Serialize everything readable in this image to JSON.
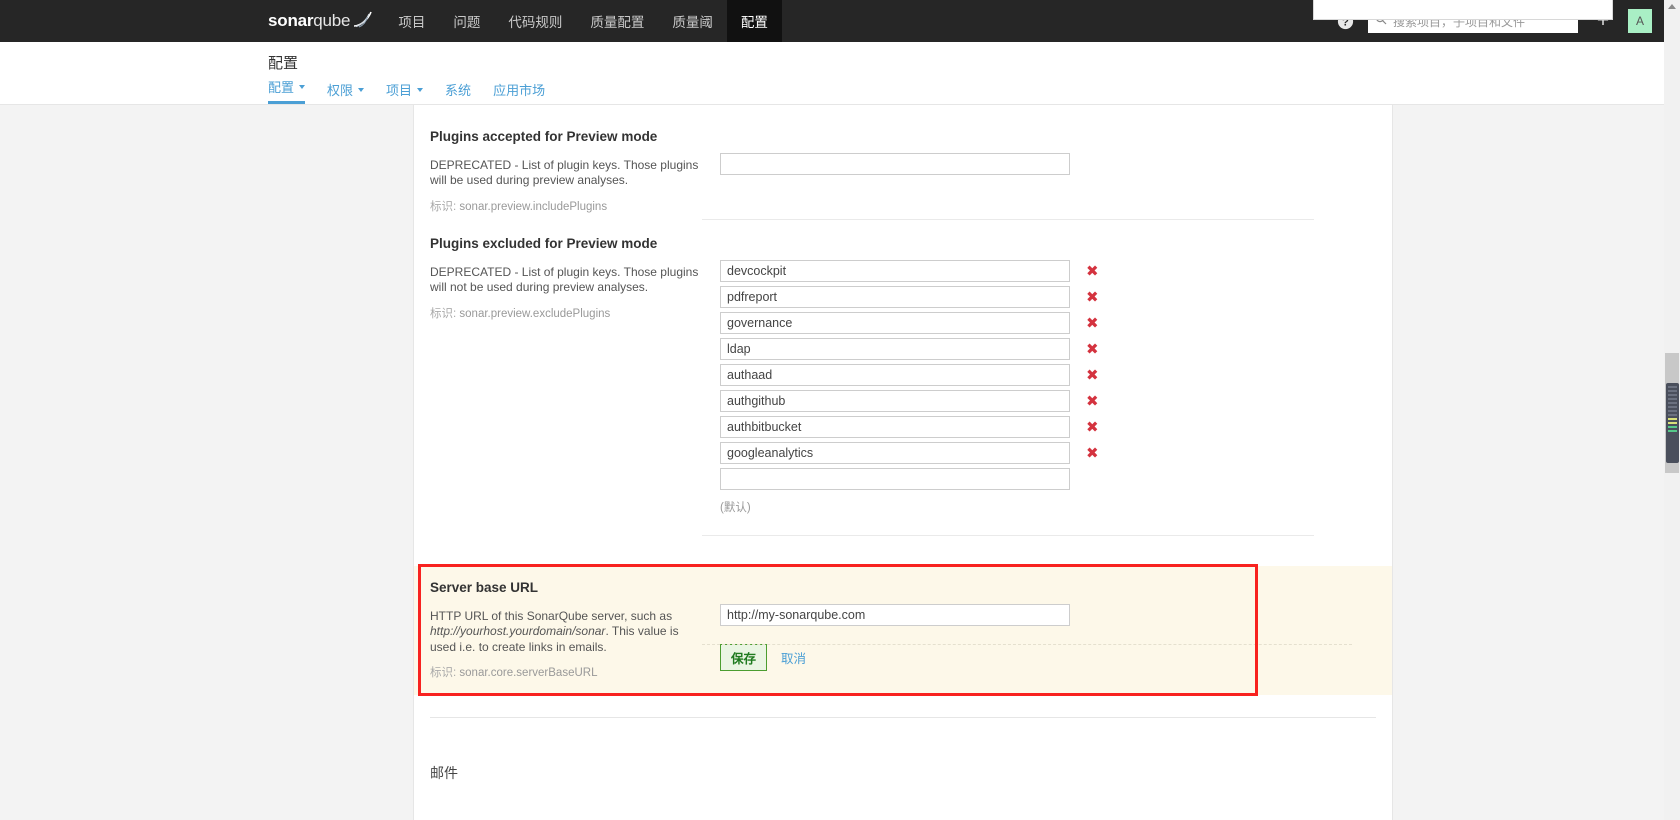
{
  "nav": {
    "brand_bold": "sonar",
    "brand_light": "qube",
    "items": [
      {
        "label": "项目",
        "active": false
      },
      {
        "label": "问题",
        "active": false
      },
      {
        "label": "代码规则",
        "active": false
      },
      {
        "label": "质量配置",
        "active": false
      },
      {
        "label": "质量阈",
        "active": false
      },
      {
        "label": "配置",
        "active": true
      }
    ],
    "help_icon": "help-circle-icon",
    "search_placeholder": "搜索项目，子项目和文件",
    "search_icon": "search-icon",
    "plus_label": "+",
    "avatar_initial": "A"
  },
  "header": {
    "title": "配置",
    "tabs": [
      {
        "label": "配置",
        "has_caret": true,
        "active": true
      },
      {
        "label": "权限",
        "has_caret": true,
        "active": false
      },
      {
        "label": "项目",
        "has_caret": true,
        "active": false
      },
      {
        "label": "系统",
        "has_caret": false,
        "active": false
      },
      {
        "label": "应用市场",
        "has_caret": false,
        "active": false
      }
    ]
  },
  "settings": {
    "accepted": {
      "title": "Plugins accepted for Preview mode",
      "description": "DEPRECATED - List of plugin keys. Those plugins will be used during preview analyses.",
      "key_label": "标识:",
      "key_value": "sonar.preview.includePlugins",
      "input_value": "",
      "delete_icon": "remove-icon"
    },
    "excluded": {
      "title": "Plugins excluded for Preview mode",
      "description": "DEPRECATED - List of plugin keys. Those plugins will not be used during preview analyses.",
      "key_label": "标识:",
      "key_value": "sonar.preview.excludePlugins",
      "values": [
        "devcockpit",
        "pdfreport",
        "governance",
        "ldap",
        "authaad",
        "authgithub",
        "authbitbucket",
        "googleanalytics"
      ],
      "empty_value": "",
      "default_note": "(默认)",
      "delete_icon": "remove-icon"
    },
    "server_base_url": {
      "title": "Server base URL",
      "desc_part1": "HTTP URL of this SonarQube server, such as ",
      "desc_italic": "http://yourhost.yourdomain/sonar",
      "desc_part2": ". This value is used i.e. to create links in emails.",
      "key_label": "标识:",
      "key_value": "sonar.core.serverBaseURL",
      "input_value": "http://my-sonarqube.com",
      "save_label": "保存",
      "cancel_label": "取消",
      "highlight_color": "#f8221f",
      "background_color": "#fdf8e9"
    },
    "email": {
      "title": "邮件"
    }
  },
  "scrollbar": {
    "up_arrow_icon": "chevron-up-icon"
  }
}
